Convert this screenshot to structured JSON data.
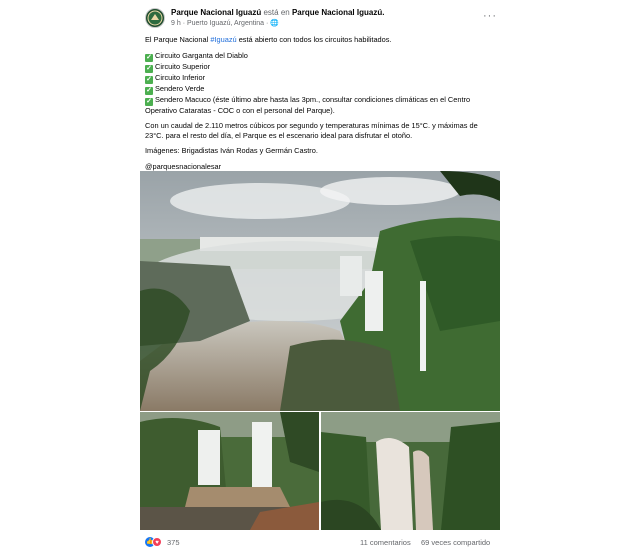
{
  "post": {
    "author": "Parque Nacional Iguazú",
    "connector": "está en",
    "location_page": "Parque Nacional Iguazú",
    "time": "9 h",
    "place": "Puerto Iguazú, Argentina",
    "more_label": "···",
    "intro_prefix": "El Parque Nacional ",
    "hashtag": "#Iguazú",
    "intro_suffix": " está abierto con todos los circuitos habilitados.",
    "circuits": [
      "Circuito Garganta del Diablo",
      "Circuito Superior",
      "Circuito Inferior",
      "Sendero Verde",
      "Sendero Macuco (éste último abre hasta las 3pm., consultar condiciones climáticas en el Centro Operativo Cataratas - COC o con el personal del Parque)."
    ],
    "paragraph": "Con un caudal de 2.110 metros cúbicos por segundo y temperaturas mínimas de 15°C. y máximas de 23°C. para el resto del día, el Parque es el escenario ideal para disfrutar el otoño.",
    "credits": "Imágenes: Brigadistas Iván Rodas y Germán Castro.",
    "handle": "@parquesnacionalesar"
  },
  "footer": {
    "reactions_count": "375",
    "comments": "11 comentarios",
    "shares": "69 veces compartido"
  },
  "icons": {
    "check": "check-mark-icon",
    "globe": "globe-icon",
    "like": "like-reaction-icon",
    "love": "love-reaction-icon"
  },
  "colors": {
    "hashtag": "#216fdb",
    "check": "#4caf50",
    "like": "#1877f2",
    "love": "#f33e58",
    "secondary_text": "#65676b"
  }
}
